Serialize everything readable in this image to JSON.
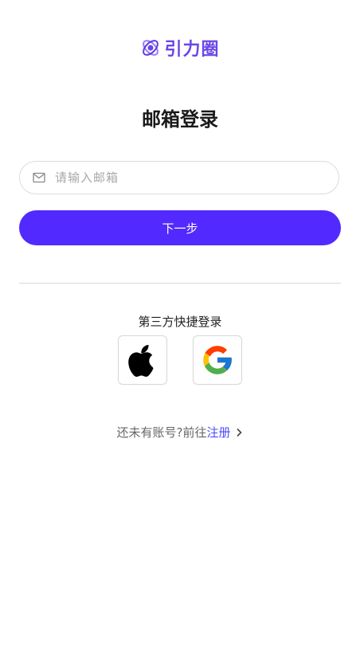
{
  "brand": {
    "name": "引力圈",
    "color": "#6b46e8",
    "icon": "orbit-logo-icon"
  },
  "page": {
    "title": "邮箱登录"
  },
  "email": {
    "placeholder": "请输入邮箱",
    "value": "",
    "icon": "mail-icon"
  },
  "next_button": {
    "label": "下一步",
    "color": "#5229ff"
  },
  "third_party": {
    "label": "第三方快捷登录",
    "providers": [
      {
        "name": "apple",
        "icon": "apple-icon"
      },
      {
        "name": "google",
        "icon": "google-icon"
      }
    ]
  },
  "register": {
    "prompt": "还未有账号?前往",
    "link": "注册",
    "link_color": "#4a4aff",
    "icon": "chevron-right-icon"
  }
}
